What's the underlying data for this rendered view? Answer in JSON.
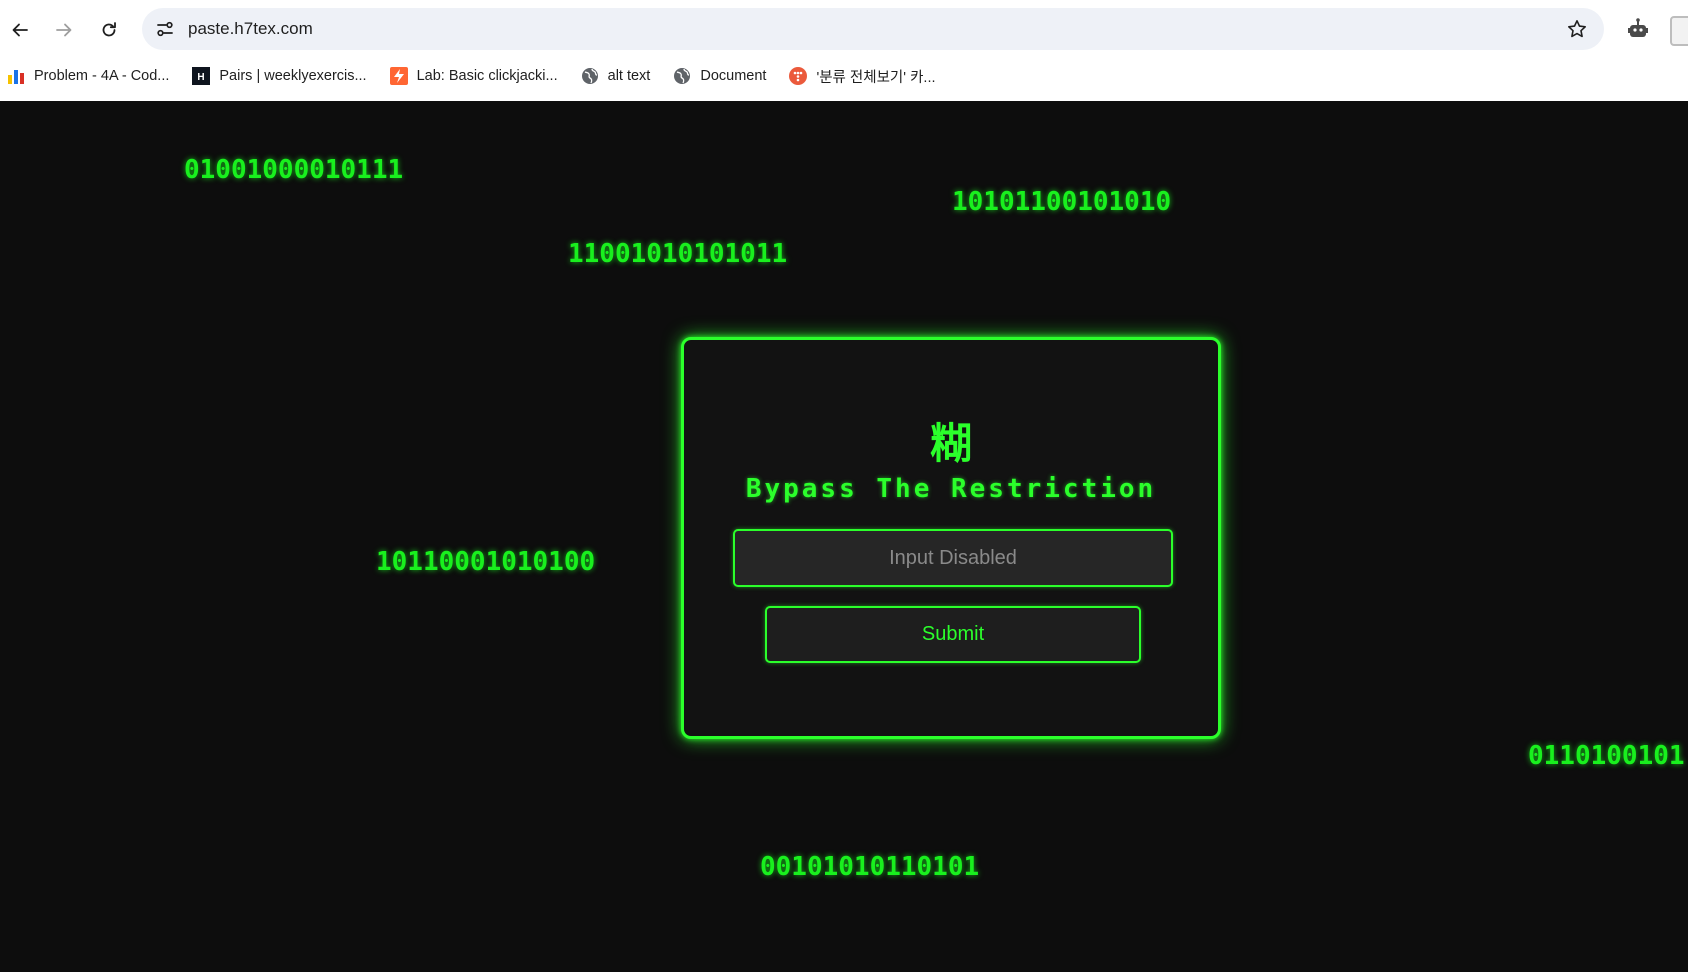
{
  "browser": {
    "url": "paste.h7tex.com",
    "bookmarks": [
      {
        "label": "Problem - 4A - Cod...",
        "icon": "codeforces-icon"
      },
      {
        "label": "Pairs | weeklyexercis...",
        "icon": "hackerrank-icon"
      },
      {
        "label": "Lab: Basic clickjacki...",
        "icon": "portswigger-icon"
      },
      {
        "label": "alt text",
        "icon": "globe-icon"
      },
      {
        "label": "Document",
        "icon": "globe-icon"
      },
      {
        "label": "'분류 전체보기' 카...",
        "icon": "tistory-icon"
      }
    ]
  },
  "page": {
    "binary_strings": [
      "01001000010111",
      "10101100101010",
      "11001010101011",
      "10110001010100",
      "0110100101",
      "00101010110101"
    ],
    "card": {
      "glyph": "糊",
      "title": "Bypass The Restriction",
      "input_placeholder": "Input Disabled",
      "submit_label": "Submit"
    },
    "accent_color": "#2bff2b",
    "background_color": "#0d0d0d"
  }
}
